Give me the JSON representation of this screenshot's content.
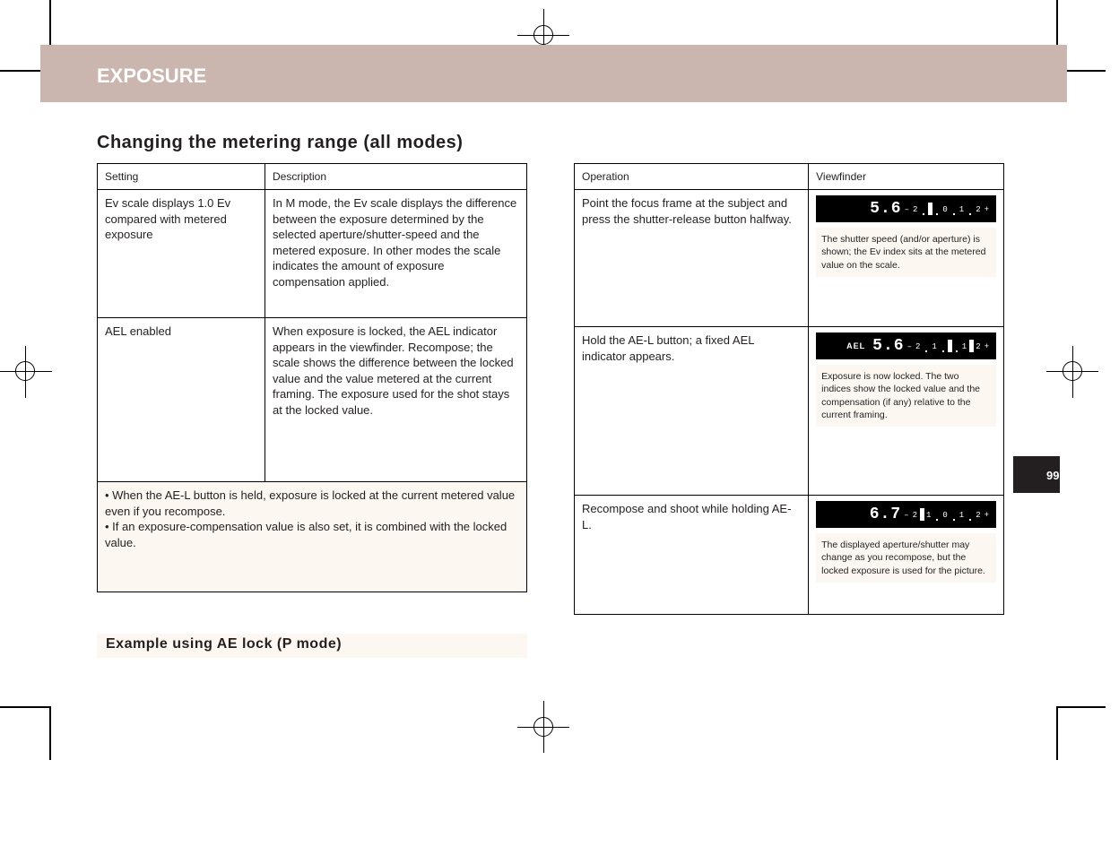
{
  "header": {
    "banner_title": "EXPOSURE"
  },
  "section": {
    "heading_left": "Changing the metering range (all modes)",
    "heading_bottom": "Example using AE lock (P mode)"
  },
  "table_left": {
    "head_col1": "Setting",
    "head_col2": "Description",
    "rows": [
      {
        "label": "Ev scale displays 1.0 Ev compared with metered exposure",
        "desc": "In M mode, the Ev scale displays the difference between the exposure determined by the selected aperture/shutter-speed and the metered exposure. In other modes the scale indicates the amount of exposure compensation applied."
      },
      {
        "label": "AEL enabled",
        "desc": "When exposure is locked, the AEL indicator appears in the viewfinder. Recompose; the scale shows the difference between the locked value and the value metered at the current framing. The exposure used for the shot stays at the locked value."
      }
    ],
    "note": "• When the AE-L button is held, exposure is locked at the current metered value even if you recompose.\n• If an exposure-compensation value is also set, it is combined with the locked value."
  },
  "table_right": {
    "head_col1": "Operation",
    "head_col2": "Viewfinder",
    "rows": [
      {
        "label": "Point the focus frame at the subject and press the shutter-release button halfway.",
        "vf": {
          "ael": false,
          "aperture": "5.6",
          "marks": [
            -1.0
          ]
        },
        "caption": "The shutter speed (and/or aperture) is shown; the Ev index sits at the metered value on the scale."
      },
      {
        "label": "Hold the AE-L button; a fixed AEL indicator appears.",
        "vf": {
          "ael": true,
          "aperture": "5.6",
          "marks": [
            0,
            1.5
          ]
        },
        "caption": "Exposure is now locked. The two indices show the locked value and the compensation (if any) relative to the current framing."
      },
      {
        "label": "Recompose and shoot while holding AE-L.",
        "vf": {
          "ael": false,
          "aperture": "6.7",
          "marks": [
            -1.5
          ]
        },
        "caption": "The displayed aperture/shutter may change as you recompose, but the locked exposure is used for the picture."
      }
    ]
  },
  "page_number": "99"
}
